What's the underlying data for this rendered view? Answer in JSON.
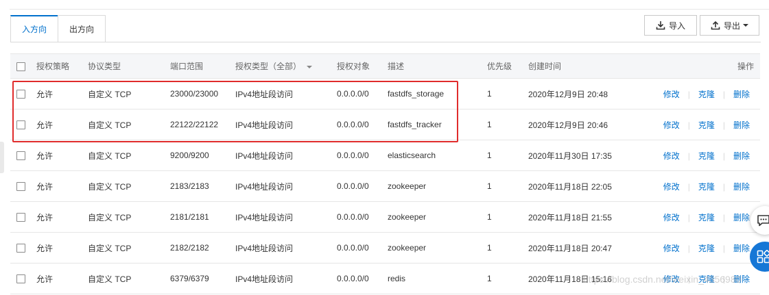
{
  "tabs": [
    {
      "label": "入方向",
      "active": true
    },
    {
      "label": "出方向",
      "active": false
    }
  ],
  "toolbar": {
    "import_label": "导入",
    "export_label": "导出"
  },
  "table": {
    "headers": {
      "policy": "授权策略",
      "protocol": "协议类型",
      "port_range": "端口范围",
      "auth_type": "授权类型（全部）",
      "auth_object": "授权对象",
      "description": "描述",
      "priority": "优先级",
      "created": "创建时间",
      "actions": "操作"
    },
    "rows": [
      {
        "policy": "允许",
        "protocol": "自定义 TCP",
        "port": "23000/23000",
        "auth_type": "IPv4地址段访问",
        "object": "0.0.0.0/0",
        "desc": "fastdfs_storage",
        "priority": "1",
        "created": "2020年12月9日 20:48"
      },
      {
        "policy": "允许",
        "protocol": "自定义 TCP",
        "port": "22122/22122",
        "auth_type": "IPv4地址段访问",
        "object": "0.0.0.0/0",
        "desc": "fastdfs_tracker",
        "priority": "1",
        "created": "2020年12月9日 20:46"
      },
      {
        "policy": "允许",
        "protocol": "自定义 TCP",
        "port": "9200/9200",
        "auth_type": "IPv4地址段访问",
        "object": "0.0.0.0/0",
        "desc": "elasticsearch",
        "priority": "1",
        "created": "2020年11月30日 17:35"
      },
      {
        "policy": "允许",
        "protocol": "自定义 TCP",
        "port": "2183/2183",
        "auth_type": "IPv4地址段访问",
        "object": "0.0.0.0/0",
        "desc": "zookeeper",
        "priority": "1",
        "created": "2020年11月18日 22:05"
      },
      {
        "policy": "允许",
        "protocol": "自定义 TCP",
        "port": "2181/2181",
        "auth_type": "IPv4地址段访问",
        "object": "0.0.0.0/0",
        "desc": "zookeeper",
        "priority": "1",
        "created": "2020年11月18日 21:55"
      },
      {
        "policy": "允许",
        "protocol": "自定义 TCP",
        "port": "2182/2182",
        "auth_type": "IPv4地址段访问",
        "object": "0.0.0.0/0",
        "desc": "zookeeper",
        "priority": "1",
        "created": "2020年11月18日 20:47"
      },
      {
        "policy": "允许",
        "protocol": "自定义 TCP",
        "port": "6379/6379",
        "auth_type": "IPv4地址段访问",
        "object": "0.0.0.0/0",
        "desc": "redis",
        "priority": "1",
        "created": "2020年11月18日 15:16"
      }
    ],
    "actions": {
      "edit": "修改",
      "clone": "克隆",
      "delete": "删除"
    }
  },
  "watermark": "https://blog.csdn.net/weixin_4356980",
  "icons": {
    "import": "download-icon",
    "export": "upload-icon",
    "float_top": "chat-icon",
    "float_bottom": "apps-icon"
  },
  "colors": {
    "accent": "#0070cc",
    "highlight": "#e02b2b",
    "float_button": "#1677d6"
  }
}
